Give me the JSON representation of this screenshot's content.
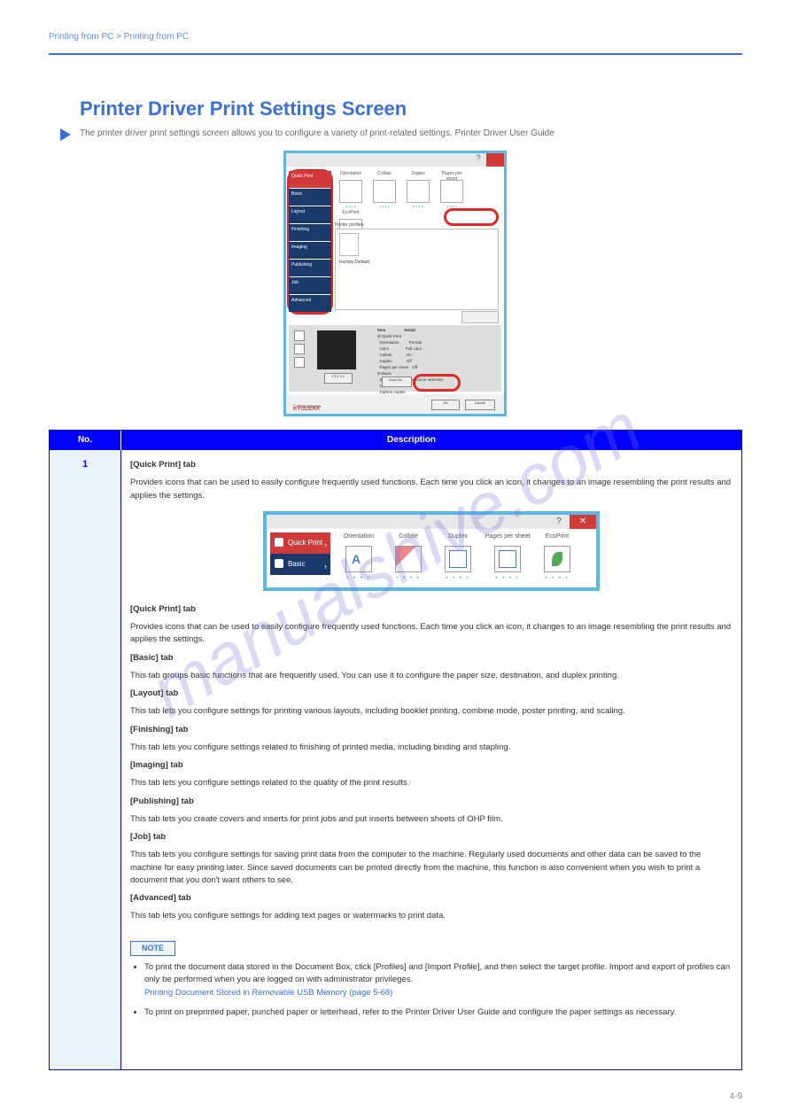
{
  "header": {
    "breadcrumb_left": "Printing from PC > Printing from PC"
  },
  "section": {
    "title": "Printer Driver Print Settings Screen",
    "subtitle": "The printer driver print settings screen allows you to configure a variety of print-related settings.\nPrinter Driver User Guide"
  },
  "dlg1": {
    "tabs": [
      "Quick Print",
      "Basic",
      "Layout",
      "Finishing",
      "Imaging",
      "Publishing",
      "Job",
      "Advanced"
    ],
    "options": [
      "Orientation",
      "Collate",
      "Duplex",
      "Pages per sheet",
      "EcoPrint"
    ],
    "profiles_label": "Printer profiles:",
    "profile_caption": "Factory Default",
    "pcl_label": "PCL XL",
    "summary": {
      "head_item": "Item",
      "head_detail": "Detail",
      "group1": "⊟ Quick Print",
      "group2": "⊟ Basic",
      "rows": [
        {
          "k": "Orientation",
          "v": "Portrait"
        },
        {
          "k": "Color",
          "v": "Full color"
        },
        {
          "k": "Collate",
          "v": "On"
        },
        {
          "k": "Duplex",
          "v": "Off"
        },
        {
          "k": "Pages per sheet",
          "v": "Off"
        },
        {
          "k": "Source",
          "v": "Auto source selection"
        },
        {
          "k": "Copies",
          "v": "1"
        },
        {
          "k": "Carbon copies",
          "v": ""
        }
      ]
    },
    "saveas": "Save As...",
    "print_preview": "Print preview",
    "ok": "OK",
    "cancel": "Cancel",
    "brand": "KYOCERA"
  },
  "dlg2": {
    "tabs": [
      "Quick Print",
      "Basic"
    ],
    "options": [
      "Orientation",
      "Collate",
      "Duplex",
      "Pages per sheet",
      "EcoPrint"
    ]
  },
  "table": {
    "head": [
      "No.",
      "Description"
    ],
    "row": {
      "no": "1",
      "title": "[Quick Print] tab",
      "p1": "Provides icons that can be used to easily configure frequently used functions. Each time you click an icon, it changes to an image resembling the print results and applies the settings.",
      "qp": {
        "title": "[Quick Print] tab",
        "desc": "Provides icons that can be used to easily configure frequently used functions. Each time you click an icon, it changes to an image resembling the print results and applies the settings."
      },
      "basic": {
        "title": "[Basic] tab",
        "desc": "This tab groups basic functions that are frequently used. You can use it to configure the paper size, destination, and duplex printing."
      },
      "layout": {
        "title": "[Layout] tab",
        "desc": "This tab lets you configure settings for printing various layouts, including booklet printing, combine mode, poster printing, and scaling."
      },
      "finishing": {
        "title": "[Finishing] tab",
        "desc": "This tab lets you configure settings related to finishing of printed media, including binding and stapling."
      },
      "imaging": {
        "title": "[Imaging] tab",
        "desc": "This tab lets you configure settings related to the quality of the print results."
      },
      "publishing": {
        "title": "[Publishing] tab",
        "desc": "This tab lets you create covers and inserts for print jobs and put inserts between sheets of OHP film."
      },
      "job": {
        "title": "[Job] tab",
        "desc": "This tab lets you configure settings for saving print data from the computer to the machine. Regularly used documents and other data can be saved to the machine for easy printing later. Since saved documents can be printed directly from the machine, this function is also convenient when you wish to print a document that you don't want others to see."
      },
      "advanced": {
        "title": "[Advanced] tab",
        "desc": "This tab lets you configure settings for adding text pages or watermarks to print data."
      },
      "note": {
        "label": "NOTE",
        "li1a": "To print the document data stored in the Document Box, click [Profiles] and [Import Profile], and then select the target profile. Import and export of profiles can only be performed when you are logged on with administrator privileges.",
        "li1ref": "Printing Document Stored in Removable USB Memory (page 5-68)",
        "li2": "To print on preprinted paper, punched paper or letterhead, refer to the Printer Driver User Guide and configure the paper settings as necessary."
      }
    }
  },
  "watermark": "manualshive.com",
  "footer": {
    "page": "4-9"
  }
}
